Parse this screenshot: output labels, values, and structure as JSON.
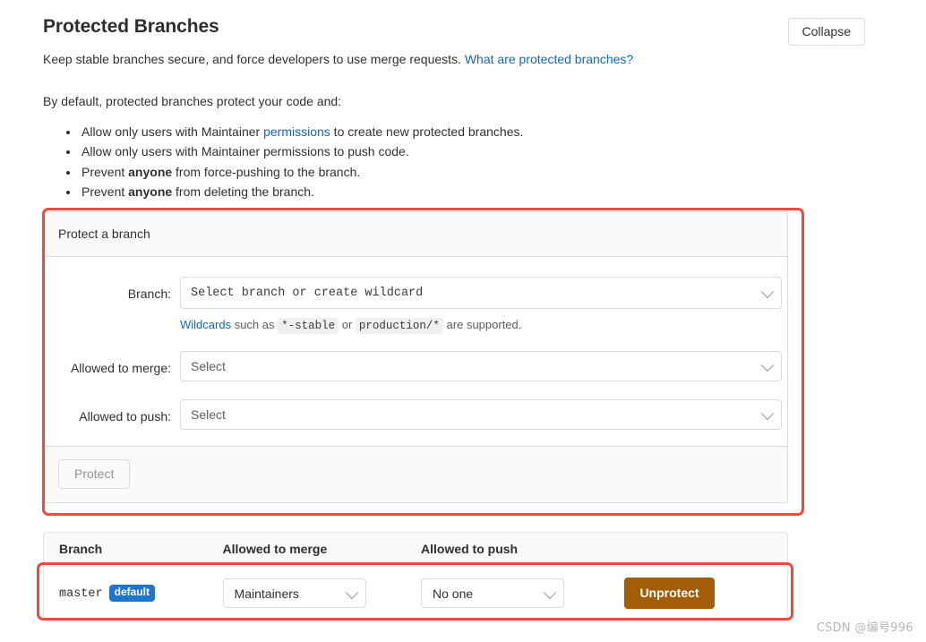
{
  "header": {
    "title": "Protected Branches",
    "collapse_label": "Collapse",
    "intro_text": "Keep stable branches secure, and force developers to use merge requests.",
    "intro_link": "What are protected branches?",
    "intro2_text": "By default, protected branches protect your code and:"
  },
  "bullets": [
    {
      "pre": "Allow only users with Maintainer ",
      "link": "permissions",
      "post": " to create new protected branches."
    },
    {
      "pre": "Allow only users with Maintainer permissions to push code.",
      "link": "",
      "post": ""
    },
    {
      "pre": "Prevent ",
      "bold": "anyone",
      "post": " from force-pushing to the branch."
    },
    {
      "pre": "Prevent ",
      "bold": "anyone",
      "post": " from deleting the branch."
    }
  ],
  "form": {
    "card_title": "Protect a branch",
    "branch_label": "Branch:",
    "branch_value": "Select branch or create wildcard",
    "help_link": "Wildcards",
    "help_mid": " such as ",
    "help_code1": "*-stable",
    "help_or": " or ",
    "help_code2": "production/*",
    "help_end": " are supported.",
    "merge_label": "Allowed to merge:",
    "merge_value": "Select",
    "push_label": "Allowed to push:",
    "push_value": "Select",
    "protect_button": "Protect"
  },
  "table": {
    "columns": [
      "Branch",
      "Allowed to merge",
      "Allowed to push",
      ""
    ],
    "rows": [
      {
        "branch": "master",
        "badge": "default",
        "merge": "Maintainers",
        "push": "No one",
        "action": "Unprotect"
      }
    ]
  },
  "watermark": "CSDN @编号996",
  "colors": {
    "link": "#1068bf",
    "badge": "#1f75cb",
    "unprotect": "#a35d06",
    "annotation": "#f04a3f"
  }
}
